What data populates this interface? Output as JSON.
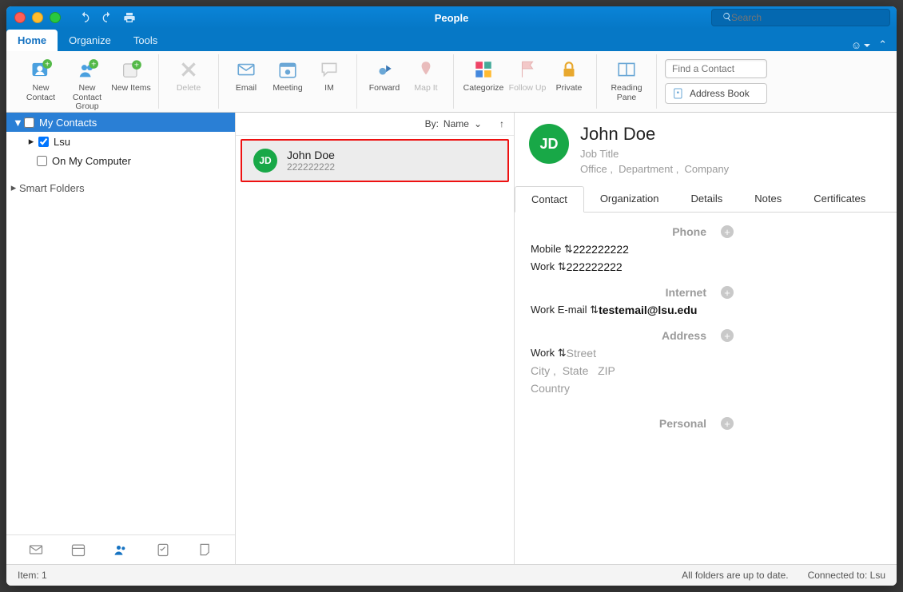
{
  "window": {
    "title": "People"
  },
  "search": {
    "placeholder": "Search"
  },
  "tabs": {
    "home": "Home",
    "organize": "Organize",
    "tools": "Tools"
  },
  "ribbon": {
    "new_contact": "New Contact",
    "new_contact_group": "New Contact Group",
    "new_items": "New Items",
    "delete": "Delete",
    "email": "Email",
    "meeting": "Meeting",
    "im": "IM",
    "forward": "Forward",
    "map_it": "Map It",
    "categorize": "Categorize",
    "follow_up": "Follow Up",
    "private": "Private",
    "reading_pane": "Reading Pane",
    "find_placeholder": "Find a Contact",
    "address_book": "Address Book"
  },
  "tree": {
    "my_contacts": "My Contacts",
    "lsu": "Lsu",
    "on_my_computer": "On My Computer",
    "smart_folders": "Smart Folders"
  },
  "list": {
    "sort_prefix": "By:",
    "sort_field": "Name",
    "item": {
      "initials": "JD",
      "name": "John Doe",
      "phone": "222222222"
    }
  },
  "detail": {
    "initials": "JD",
    "name": "John  Doe",
    "job_title": "Job Title",
    "office": "Office",
    "department": "Department",
    "company": "Company",
    "tabs": {
      "contact": "Contact",
      "organization": "Organization",
      "details": "Details",
      "notes": "Notes",
      "certificates": "Certificates"
    },
    "sections": {
      "phone": "Phone",
      "mobile_label": "Mobile",
      "mobile_value": "222222222",
      "work_phone_label": "Work",
      "work_phone_value": "222222222",
      "internet": "Internet",
      "work_email_label": "Work E-mail",
      "work_email_value": "testemail@lsu.edu",
      "address": "Address",
      "addr_label": "Work",
      "street": "Street",
      "city": "City",
      "state": "State",
      "zip": "ZIP",
      "country": "Country",
      "personal": "Personal"
    }
  },
  "footer": {
    "item_count": "Item: 1",
    "status": "All folders are up to date.",
    "connected": "Connected to: Lsu"
  }
}
